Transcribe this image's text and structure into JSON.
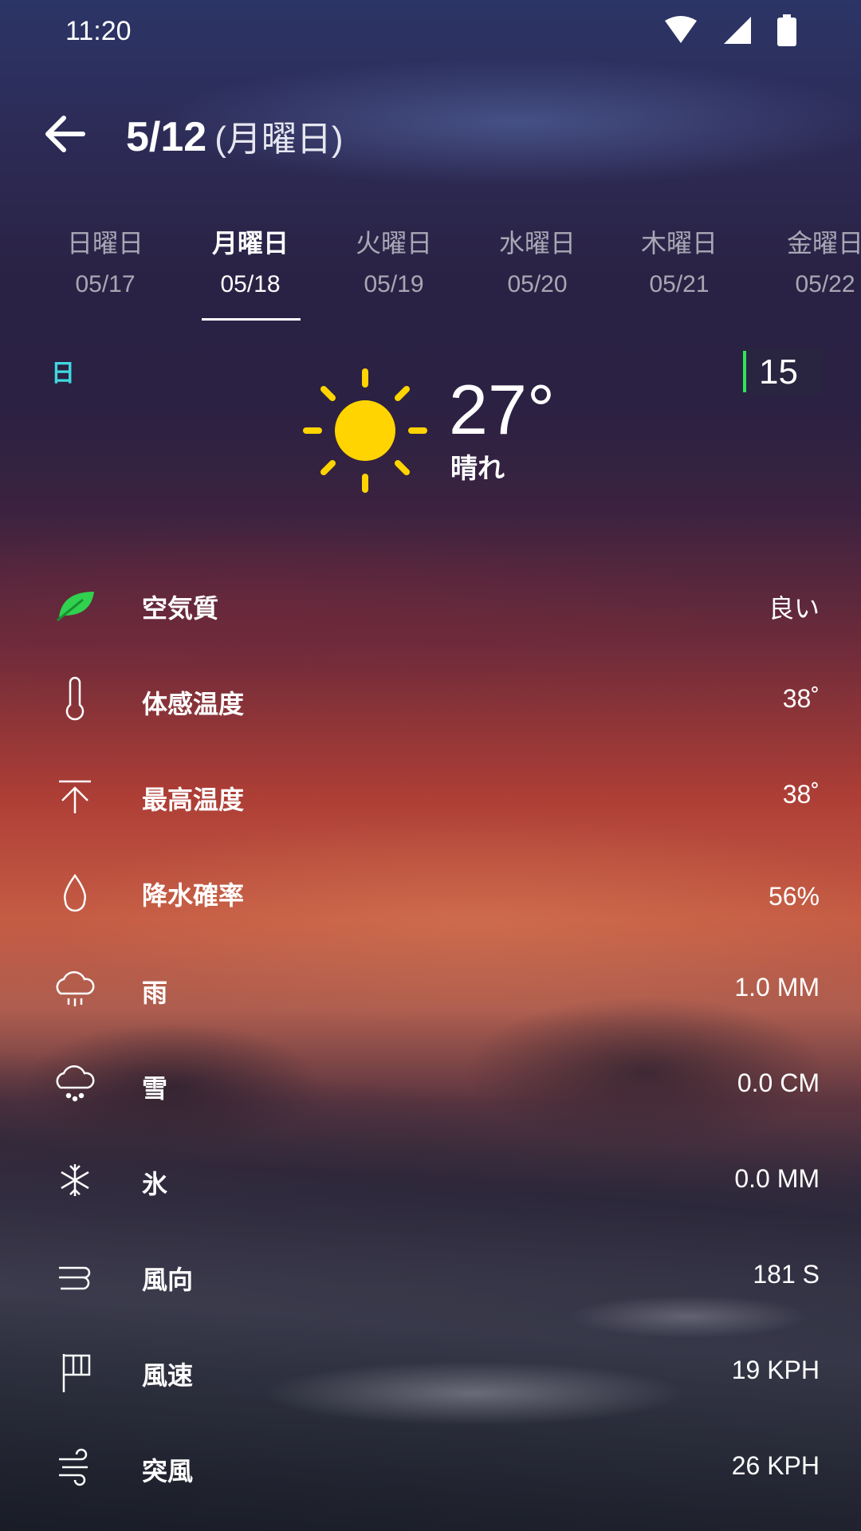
{
  "status_bar": {
    "time": "11:20"
  },
  "header": {
    "date": "5/12",
    "weekday": "(月曜日)"
  },
  "tabs": [
    {
      "day": "日曜日",
      "date": "05/17",
      "active": false
    },
    {
      "day": "月曜日",
      "date": "05/18",
      "active": true
    },
    {
      "day": "火曜日",
      "date": "05/19",
      "active": false
    },
    {
      "day": "水曜日",
      "date": "05/20",
      "active": false
    },
    {
      "day": "木曜日",
      "date": "05/21",
      "active": false
    },
    {
      "day": "金曜日",
      "date": "05/22",
      "active": false
    }
  ],
  "current": {
    "period_label": "日",
    "badge_number": "15",
    "temperature": "27°",
    "condition": "晴れ",
    "icon": "sun-icon",
    "accent_colors": {
      "period": "#3fd8e0",
      "badge_bar": "#2ee55c",
      "sun": "#ffd400"
    }
  },
  "details": [
    {
      "icon": "leaf-icon",
      "label": "空気質",
      "value": "良い"
    },
    {
      "icon": "thermometer-icon",
      "label": "体感温度",
      "value": "38˚"
    },
    {
      "icon": "arrow-up-icon",
      "label": "最高温度",
      "value": "38˚"
    },
    {
      "icon": "droplet-icon",
      "label": "降水確率",
      "value": "56%"
    },
    {
      "icon": "rain-cloud-icon",
      "label": "雨",
      "value": "1.0 MM"
    },
    {
      "icon": "snow-cloud-icon",
      "label": "雪",
      "value": "0.0 CM"
    },
    {
      "icon": "snowflake-icon",
      "label": "氷",
      "value": "0.0 MM"
    },
    {
      "icon": "wind-direction-icon",
      "label": "風向",
      "value": "181 S"
    },
    {
      "icon": "flag-icon",
      "label": "風速",
      "value": "19 KPH"
    },
    {
      "icon": "gust-icon",
      "label": "突風",
      "value": "26 KPH"
    }
  ]
}
